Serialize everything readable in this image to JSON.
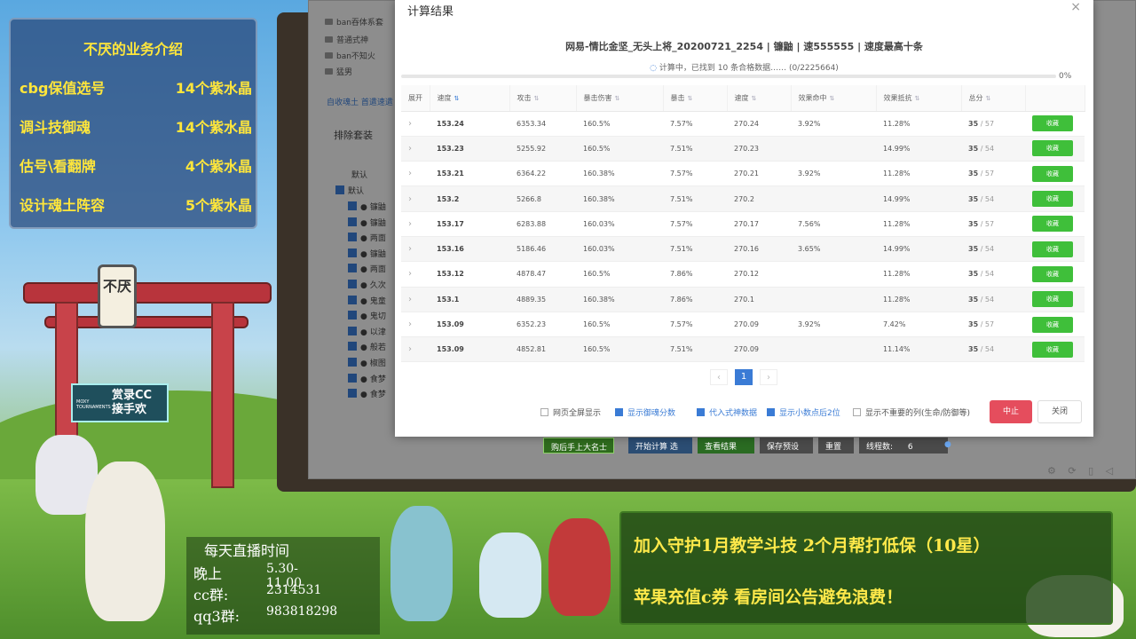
{
  "promo": {
    "title": "不厌的业务介绍",
    "rows": [
      {
        "label": "cbg保值选号",
        "price": "14个紫水晶"
      },
      {
        "label": "调斗技御魂",
        "price": "14个紫水晶"
      },
      {
        "label": "估号\\看翻牌",
        "price": "4个紫水晶"
      },
      {
        "label": "设计魂土阵容",
        "price": "5个紫水晶"
      }
    ]
  },
  "sign": "不厌",
  "logo_badge": {
    "small": "MOXY TOURNAMENTS",
    "text": "赏录CC 接手欢"
  },
  "schedule": {
    "title": "每天直播时间",
    "evening_label": "晚上",
    "evening_value": "5.30-11.00",
    "cc_label": "cc群:",
    "cc_value": "2314531",
    "qq_label": "qq3群:",
    "qq_value": "983818298"
  },
  "banner": {
    "line1": "加入守护1月教学斗技  2个月帮打低保（10星）",
    "line2": "苹果充值c券  看房间公告避免浪费！"
  },
  "app": {
    "tree": [
      "ban吞体系套",
      "普通式神",
      "ban不知火",
      "猛男"
    ],
    "link": "自收魂土 首遣速遣",
    "exclude_title": "排除套装",
    "default_label_1": "默认",
    "default_label_2": "默认",
    "shikigami": [
      "镰鼬",
      "镰鼬",
      "两面",
      "镰鼬",
      "两面",
      "久次",
      "鬼童",
      "鬼切",
      "以津",
      "般若",
      "椒图",
      "食梦",
      "食梦"
    ],
    "bottom_buttons": [
      "购后手上大名士",
      "开始计算 选",
      "查看结果",
      "保存预设",
      "重置"
    ],
    "thread_label": "线程数:",
    "thread_value": "6"
  },
  "dialog": {
    "title": "计算结果",
    "subtitle": "网易-情比金坚_无头上将_20200721_2254 | 镰鼬 | 速555555 | 速度最高十条",
    "status": "计算中，已找到 10 条合格数据…… (0/2225664)",
    "progress_label": "0%",
    "progress": 0,
    "columns": [
      "展开",
      "速度",
      "攻击",
      "暴击伤害",
      "暴击",
      "速度",
      "效果命中",
      "效果抵抗",
      "总分",
      ""
    ],
    "rows": [
      {
        "speed": "153.24",
        "atk": "6353.34",
        "cdmg": "160.5%",
        "crit": "7.57%",
        "spd2": "270.24",
        "hit": "3.92%",
        "res": "11.28%",
        "score": "35",
        "total": "/ 57"
      },
      {
        "speed": "153.23",
        "atk": "5255.92",
        "cdmg": "160.5%",
        "crit": "7.51%",
        "spd2": "270.23",
        "hit": "",
        "res": "14.99%",
        "score": "35",
        "total": "/ 54"
      },
      {
        "speed": "153.21",
        "atk": "6364.22",
        "cdmg": "160.38%",
        "crit": "7.57%",
        "spd2": "270.21",
        "hit": "3.92%",
        "res": "11.28%",
        "score": "35",
        "total": "/ 57"
      },
      {
        "speed": "153.2",
        "atk": "5266.8",
        "cdmg": "160.38%",
        "crit": "7.51%",
        "spd2": "270.2",
        "hit": "",
        "res": "14.99%",
        "score": "35",
        "total": "/ 54"
      },
      {
        "speed": "153.17",
        "atk": "6283.88",
        "cdmg": "160.03%",
        "crit": "7.57%",
        "spd2": "270.17",
        "hit": "7.56%",
        "res": "11.28%",
        "score": "35",
        "total": "/ 57"
      },
      {
        "speed": "153.16",
        "atk": "5186.46",
        "cdmg": "160.03%",
        "crit": "7.51%",
        "spd2": "270.16",
        "hit": "3.65%",
        "res": "14.99%",
        "score": "35",
        "total": "/ 54"
      },
      {
        "speed": "153.12",
        "atk": "4878.47",
        "cdmg": "160.5%",
        "crit": "7.86%",
        "spd2": "270.12",
        "hit": "",
        "res": "11.28%",
        "score": "35",
        "total": "/ 54"
      },
      {
        "speed": "153.1",
        "atk": "4889.35",
        "cdmg": "160.38%",
        "crit": "7.86%",
        "spd2": "270.1",
        "hit": "",
        "res": "11.28%",
        "score": "35",
        "total": "/ 54"
      },
      {
        "speed": "153.09",
        "atk": "6352.23",
        "cdmg": "160.5%",
        "crit": "7.57%",
        "spd2": "270.09",
        "hit": "3.92%",
        "res": "7.42%",
        "score": "35",
        "total": "/ 57"
      },
      {
        "speed": "153.09",
        "atk": "4852.81",
        "cdmg": "160.5%",
        "crit": "7.51%",
        "spd2": "270.09",
        "hit": "",
        "res": "11.14%",
        "score": "35",
        "total": "/ 54"
      }
    ],
    "fav_label": "收藏",
    "page": "1",
    "options": [
      {
        "label": "网页全屏显示",
        "on": false
      },
      {
        "label": "显示御魂分数",
        "on": true
      },
      {
        "label": "代入式神数据",
        "on": true
      },
      {
        "label": "显示小数点后2位",
        "on": true
      },
      {
        "label": "显示不重要的列(生命/防御等)",
        "on": false
      }
    ],
    "stop_label": "中止",
    "close_label": "关闭"
  },
  "colors": {
    "accent": "#3a7bd5",
    "fav": "#3fbf3a",
    "stop": "#e54d5d"
  }
}
